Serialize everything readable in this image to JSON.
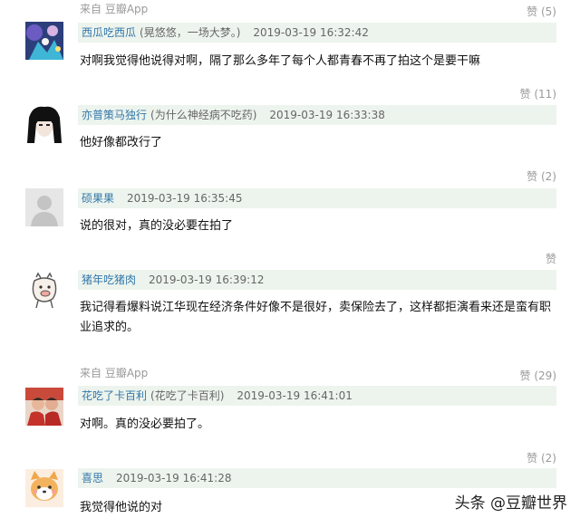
{
  "comments": [
    {
      "source": "来自 豆瓣App",
      "like": "赞 (5)",
      "user": "西瓜吃西瓜",
      "signature": "(晃悠悠，一场大梦。)",
      "time": "2019-03-19 16:32:42",
      "text": "对啊我觉得他说得对啊，隔了那么多年了每个人都青春不再了拍这个是要干嘛"
    },
    {
      "like": "赞 (11)",
      "user": "亦普策马独行",
      "signature": "(为什么神经病不吃药)",
      "time": "2019-03-19 16:33:38",
      "text": "他好像都改行了"
    },
    {
      "like": "赞 (2)",
      "user": "硕果果",
      "time": "2019-03-19 16:35:45",
      "text": "说的很对，真的没必要在拍了"
    },
    {
      "like": "赞",
      "user": "猪年吃猪肉",
      "time": "2019-03-19 16:39:12",
      "text": "我记得看爆料说江华现在经济条件好像不是很好，卖保险去了，这样都拒演看来还是蛮有职业追求的。"
    },
    {
      "source": "来自 豆瓣App",
      "like": "赞 (29)",
      "user": "花吃了卡百利",
      "signature": "(花吃了卡百利)",
      "time": "2019-03-19 16:41:01",
      "text": "对啊。真的没必要拍了。"
    },
    {
      "like": "赞 (2)",
      "user": "喜思",
      "time": "2019-03-19 16:41:28",
      "text": "我觉得他说的对"
    }
  ],
  "watermark": "头条 @豆瓣世界"
}
